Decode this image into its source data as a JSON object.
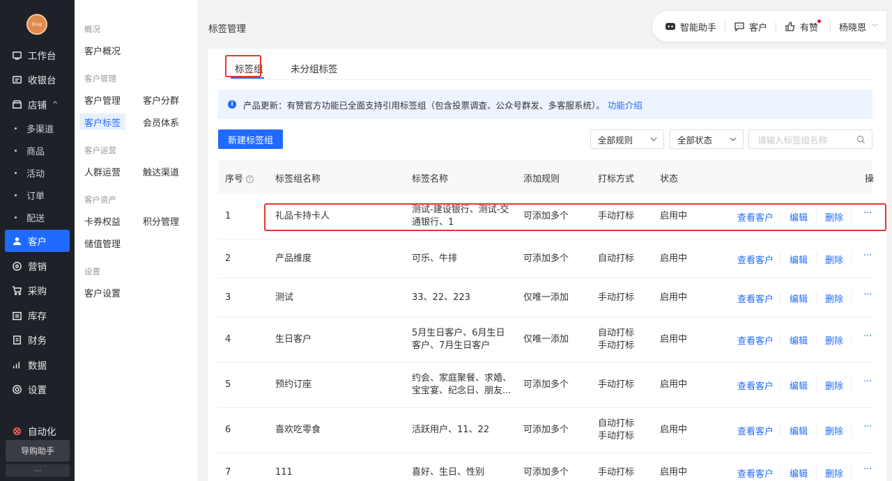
{
  "sidebar": {
    "logo_text": "Shop",
    "items": [
      {
        "label": "工作台",
        "icon": "workbench-icon"
      },
      {
        "label": "收银台",
        "icon": "cashier-icon"
      },
      {
        "label": "店铺",
        "icon": "store-icon"
      },
      {
        "label": "客户",
        "icon": "customer-icon"
      },
      {
        "label": "营销",
        "icon": "marketing-icon"
      },
      {
        "label": "采购",
        "icon": "cart-icon"
      },
      {
        "label": "库存",
        "icon": "inventory-icon"
      },
      {
        "label": "财务",
        "icon": "finance-icon"
      },
      {
        "label": "数据",
        "icon": "data-icon"
      },
      {
        "label": "设置",
        "icon": "settings-icon"
      },
      {
        "label": "自动化",
        "icon": "automation-icon"
      }
    ],
    "store_subitems": [
      "多渠道",
      "商品",
      "活动",
      "订单",
      "配送"
    ],
    "bottom_button": "导购助手",
    "bottom_more": "···"
  },
  "subnav": {
    "groups": [
      {
        "title": "概况",
        "items": [
          "客户概况"
        ]
      },
      {
        "title": "客户管理",
        "items": [
          "客户管理",
          "客户分群",
          "客户标签",
          "会员体系"
        ]
      },
      {
        "title": "客户运营",
        "items": [
          "人群运营",
          "触达渠道"
        ]
      },
      {
        "title": "客户资产",
        "items": [
          "卡券权益",
          "积分管理",
          "储值管理"
        ]
      },
      {
        "title": "设置",
        "items": [
          "客户设置"
        ]
      }
    ]
  },
  "header": {
    "page_title": "标签管理",
    "assistant": "智能助手",
    "customer": "客户",
    "youzan": "有赞",
    "user": "杨晓恩"
  },
  "tabs": [
    "标签组",
    "未分组标签"
  ],
  "notice": {
    "text": "产品更新：有赞官方功能已全面支持引用标签组（包含投票调查、公众号群发、多客服系统）。",
    "link": "功能介绍"
  },
  "toolbar": {
    "new_button": "新建标签组",
    "rule_select": "全部规则",
    "status_select": "全部状态",
    "search_placeholder": "请输入标签组名称"
  },
  "table": {
    "headers": [
      "序号",
      "标签组名称",
      "标签名称",
      "添加规则",
      "打标方式",
      "状态",
      "操"
    ],
    "op_labels": [
      "查看客户",
      "编辑",
      "删除",
      "···"
    ],
    "rows": [
      {
        "no": "1",
        "group": "礼品卡持卡人",
        "tags": [
          "测试-建设银行、测试-交",
          "通银行、1"
        ],
        "rule": "可添加多个",
        "method": [
          "手动打标"
        ],
        "status": "启用中"
      },
      {
        "no": "2",
        "group": "产品维度",
        "tags": [
          "可乐、牛排"
        ],
        "rule": "可添加多个",
        "method": [
          "自动打标"
        ],
        "status": "启用中"
      },
      {
        "no": "3",
        "group": "测试",
        "tags": [
          "33、22、223"
        ],
        "rule": "仅唯一添加",
        "method": [
          "手动打标"
        ],
        "status": "启用中"
      },
      {
        "no": "4",
        "group": "生日客户",
        "tags": [
          "5月生日客户、6月生日",
          "客户、7月生日客户"
        ],
        "rule": "仅唯一添加",
        "method": [
          "自动打标",
          "手动打标"
        ],
        "status": "启用中"
      },
      {
        "no": "5",
        "group": "预约订座",
        "tags": [
          "约会、家庭聚餐、求婚、",
          "宝宝宴、纪念日、朋友..."
        ],
        "rule": "可添加多个",
        "method": [
          "手动打标"
        ],
        "status": "启用中"
      },
      {
        "no": "6",
        "group": "喜欢吃零食",
        "tags": [
          "活跃用户、11、22"
        ],
        "rule": "可添加多个",
        "method": [
          "自动打标",
          "手动打标"
        ],
        "status": "启用中"
      },
      {
        "no": "7",
        "group": "111",
        "tags": [
          "喜好、生日、性别"
        ],
        "rule": "可添加多个",
        "method": [
          "手动打标"
        ],
        "status": "启用中"
      }
    ]
  },
  "colors": {
    "primary": "#1f6bff",
    "sidebar": "#1f2129",
    "highlight": "#e5352b"
  }
}
